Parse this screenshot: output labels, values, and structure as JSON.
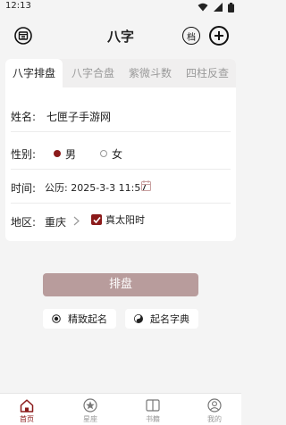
{
  "status_bar": {
    "time": "12:13"
  },
  "header": {
    "title": "八字",
    "archive_label": "档"
  },
  "tabs": [
    {
      "label": "八字排盘",
      "active": true
    },
    {
      "label": "八字合盘",
      "active": false
    },
    {
      "label": "紫微斗数",
      "active": false
    },
    {
      "label": "四柱反查",
      "active": false
    }
  ],
  "form": {
    "name_label": "姓名:",
    "name_value": "七匣子手游网",
    "gender_label": "性别:",
    "gender_male": "男",
    "gender_female": "女",
    "gender_selected": "男",
    "time_label": "时间:",
    "time_value": "公历: 2025-3-3 11:57",
    "region_label": "地区:",
    "region_value": "重庆",
    "true_solar_label": "真太阳时",
    "true_solar_checked": true
  },
  "actions": {
    "submit_label": "排盘",
    "naming_label": "精致起名",
    "dictionary_label": "起名字典"
  },
  "bottom_nav": [
    {
      "label": "首页",
      "icon": "home-icon",
      "active": true
    },
    {
      "label": "星座",
      "icon": "star-icon",
      "active": false
    },
    {
      "label": "书籍",
      "icon": "book-icon",
      "active": false
    },
    {
      "label": "我的",
      "icon": "profile-icon",
      "active": false
    }
  ],
  "colors": {
    "accent": "#8b1a1a",
    "submit_bg": "#b89c9c",
    "page_bg": "#f4f4f4"
  }
}
